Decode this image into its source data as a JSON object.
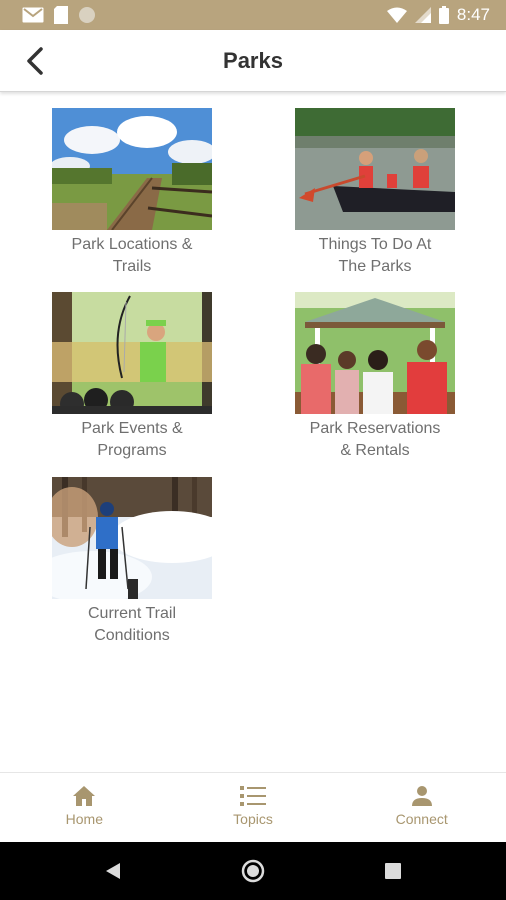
{
  "status_bar": {
    "time": "8:47",
    "icons": [
      "gmail-icon",
      "sd-card-icon",
      "circle-icon",
      "wifi-icon",
      "signal-icon",
      "battery-icon"
    ]
  },
  "header": {
    "title": "Parks",
    "back_icon": "chevron-left-icon"
  },
  "tiles": [
    {
      "label_line1": "Park Locations &",
      "label_line2": "Trails",
      "image": "boardwalk-trail-photo"
    },
    {
      "label_line1": "Things To Do At",
      "label_line2": "The Parks",
      "image": "canoe-photo"
    },
    {
      "label_line1": "Park Events &",
      "label_line2": "Programs",
      "image": "archery-photo"
    },
    {
      "label_line1": "Park Reservations",
      "label_line2": "& Rentals",
      "image": "pavilion-picnic-photo"
    },
    {
      "label_line1": "Current Trail",
      "label_line2": "Conditions",
      "image": "cross-country-ski-photo"
    }
  ],
  "bottom_nav": [
    {
      "label": "Home",
      "icon": "home-icon"
    },
    {
      "label": "Topics",
      "icon": "list-icon"
    },
    {
      "label": "Connect",
      "icon": "person-icon"
    }
  ],
  "colors": {
    "status_bar": "#b8a47e",
    "nav_accent": "#a8966f",
    "label_text": "#6f6f6f"
  }
}
